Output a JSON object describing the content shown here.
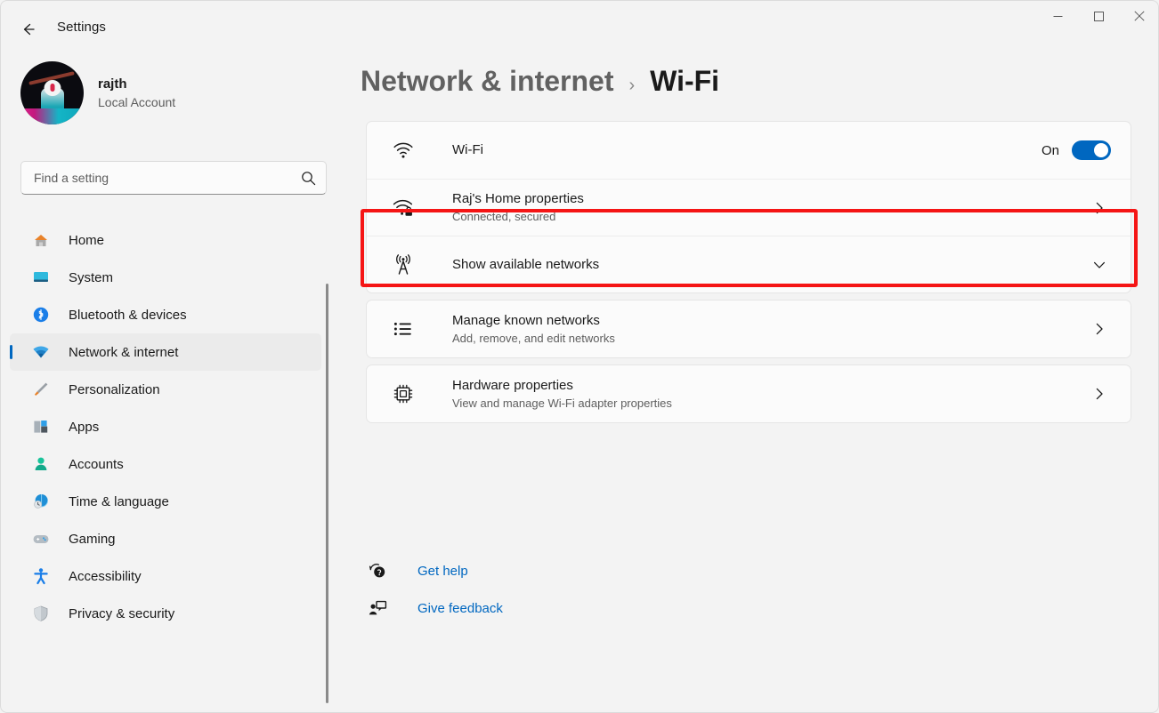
{
  "window": {
    "app_title": "Settings",
    "back_icon": "arrow-left-icon",
    "controls": {
      "minimize": "minimize-icon",
      "maximize": "maximize-icon",
      "close": "close-icon"
    }
  },
  "sidebar": {
    "account": {
      "name": "rajth",
      "subtitle": "Local Account",
      "avatar_icon": "user-avatar"
    },
    "search": {
      "value": "",
      "placeholder": "Find a setting",
      "icon": "search-icon"
    },
    "items": [
      {
        "label": "Home",
        "icon": "home-icon",
        "selected": false
      },
      {
        "label": "System",
        "icon": "system-icon",
        "selected": false
      },
      {
        "label": "Bluetooth & devices",
        "icon": "bluetooth-icon",
        "selected": false
      },
      {
        "label": "Network & internet",
        "icon": "wifi-icon",
        "selected": true
      },
      {
        "label": "Personalization",
        "icon": "paintbrush-icon",
        "selected": false
      },
      {
        "label": "Apps",
        "icon": "apps-icon",
        "selected": false
      },
      {
        "label": "Accounts",
        "icon": "accounts-icon",
        "selected": false
      },
      {
        "label": "Time & language",
        "icon": "clock-globe-icon",
        "selected": false
      },
      {
        "label": "Gaming",
        "icon": "gamepad-icon",
        "selected": false
      },
      {
        "label": "Accessibility",
        "icon": "accessibility-icon",
        "selected": false
      },
      {
        "label": "Privacy & security",
        "icon": "shield-icon",
        "selected": false
      }
    ]
  },
  "breadcrumb": {
    "parent": "Network & internet",
    "separator": "›",
    "current": "Wi-Fi"
  },
  "settings_rows": {
    "wifi_toggle": {
      "title": "Wi-Fi",
      "icon": "wifi-icon",
      "state_label": "On",
      "toggle_on": true
    },
    "network_properties": {
      "title": "Raj's Home properties",
      "subtitle": "Connected, secured",
      "icon": "wifi-lock-icon",
      "chevron": "chevron-right-icon",
      "highlighted": true
    },
    "show_available": {
      "title": "Show available networks",
      "icon": "broadcast-tower-icon",
      "chevron": "chevron-down-icon"
    },
    "manage_known": {
      "title": "Manage known networks",
      "subtitle": "Add, remove, and edit networks",
      "icon": "list-icon",
      "chevron": "chevron-right-icon"
    },
    "hardware_properties": {
      "title": "Hardware properties",
      "subtitle": "View and manage Wi-Fi adapter properties",
      "icon": "chip-icon",
      "chevron": "chevron-right-icon"
    }
  },
  "footer": {
    "get_help": {
      "label": "Get help",
      "icon": "help-icon"
    },
    "give_feedback": {
      "label": "Give feedback",
      "icon": "feedback-icon"
    }
  },
  "colors": {
    "accent": "#0067c0",
    "highlight_border": "#f51515",
    "page_background": "#f3f3f3",
    "card_background": "#fbfbfb",
    "link": "#0067c0"
  }
}
